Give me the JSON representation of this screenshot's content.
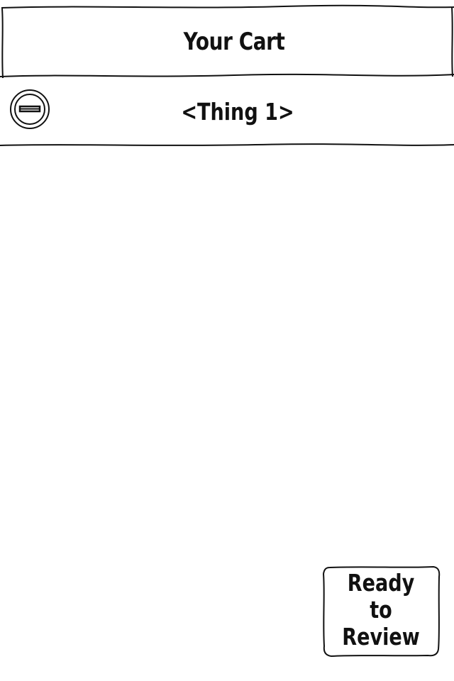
{
  "header": {
    "title": "Your Cart"
  },
  "cart": {
    "items": [
      {
        "label": "<Thing 1>",
        "remove_icon": "minus-circle-icon"
      }
    ]
  },
  "footer": {
    "review_button": {
      "line1": "Ready",
      "line2": "to",
      "line3": "Review"
    }
  },
  "colors": {
    "stroke": "#111111",
    "background": "#ffffff"
  }
}
